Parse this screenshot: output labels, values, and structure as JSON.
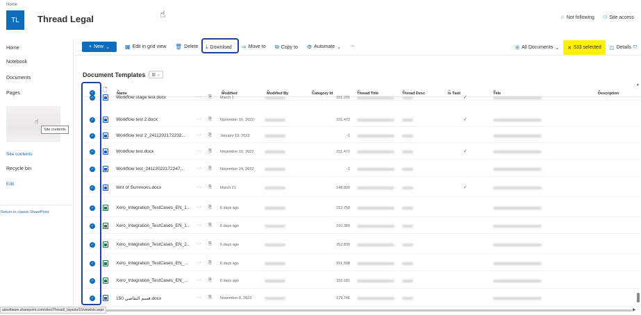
{
  "site": {
    "breadcrumb": "Home",
    "logo_initials": "TL",
    "title": "Thread Legal",
    "not_following": "Not following",
    "site_access": "Site access",
    "accent": "#0f6cbd"
  },
  "leftnav": {
    "items": [
      "Home",
      "Notebook",
      "Documents",
      "Pages"
    ],
    "site_contents": "Site contents",
    "recycle_bin": "Recycle bin",
    "edit": "Edit",
    "return_classic": "Return to classic SharePoint",
    "tooltip": "Site contents"
  },
  "commandbar": {
    "new": "New",
    "edit_grid": "Edit in grid view",
    "delete": "Delete",
    "download": "Download",
    "move_to": "Move to",
    "copy_to": "Copy to",
    "automate": "Automate",
    "overflow": "···",
    "all_documents": "All Documents",
    "selected": "533 selected",
    "details": "Details",
    "selected_color": "#fff100"
  },
  "library": {
    "title": "Document Templates"
  },
  "grid": {
    "columns": {
      "name": "Name",
      "modified": "Modified",
      "modified_by": "Modified By",
      "category_id": "Category Id",
      "thread_title": "Thread Title",
      "thread_desc": "Thread Desc",
      "is_task": "Is Task",
      "title": "Title",
      "description": "Description"
    },
    "rows": [
      {
        "name": "Workflow stage test.docx",
        "modified": "March 1",
        "category": "151,201",
        "type": "word",
        "task": "✓"
      },
      {
        "name": "Workflow test 2.docx",
        "modified": "November 10, 2022",
        "category": "151,472",
        "type": "word",
        "task": "✓"
      },
      {
        "name": "Workflow test 2_2411202172232...",
        "modified": "January 19, 2023",
        "category": "-1",
        "type": "word",
        "task": ""
      },
      {
        "name": "Workflow test.docx",
        "modified": "November 10, 2022",
        "category": "151,472",
        "type": "word",
        "task": "✓"
      },
      {
        "name": "Workflow test_24112022172247...",
        "modified": "November 24, 2022",
        "category": "-1",
        "type": "word",
        "task": ""
      },
      {
        "name": "Writ of Summons.docx",
        "modified": "March 21",
        "category": "148,820",
        "type": "word",
        "task": "✓"
      },
      {
        "name": "Xero_Integration_TestCases_EN_1...",
        "modified": "6 days ago",
        "category": "213,759",
        "type": "excel",
        "task": ""
      },
      {
        "name": "Xero_Integration_TestCases_EN_1...",
        "modified": "6 days ago",
        "category": "210,389",
        "type": "excel",
        "task": ""
      },
      {
        "name": "Xero_Integration_TestCases_EN_2...",
        "modified": "6 days ago",
        "category": "252,839",
        "type": "excel",
        "task": ""
      },
      {
        "name": "Xero_Integration_TestCases_EN_...",
        "modified": "6 days ago",
        "category": "151,508",
        "type": "excel",
        "task": ""
      },
      {
        "name": "Xero_Integration_TestCases_EN_...",
        "modified": "6 days ago",
        "category": "316,181",
        "type": "excel",
        "task": ""
      },
      {
        "name": "150 قسم التقاضي.docx",
        "modified": "November 8, 2022",
        "category": "179,746",
        "type": "word",
        "task": ""
      }
    ]
  },
  "status": {
    "url": "adsoftware.sharepoint.com/sites/Thread/_layouts/15/viewlsts.aspx"
  }
}
